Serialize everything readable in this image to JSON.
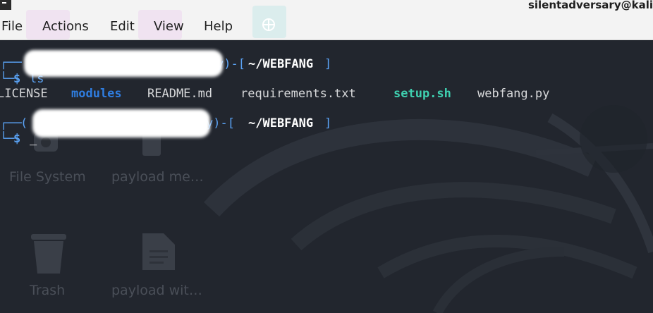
{
  "window": {
    "title": "silentadversary@kali"
  },
  "menubar": {
    "items": [
      "File",
      "Actions",
      "Edit",
      "View",
      "Help"
    ]
  },
  "terminal": {
    "prompt1": {
      "suffix": "y)-[",
      "path": "~/WEBFANG",
      "close": "]",
      "dollar": "$",
      "command": "ls"
    },
    "listing": [
      {
        "name": "LICENSE",
        "kind": "file"
      },
      {
        "name": "modules",
        "kind": "dir"
      },
      {
        "name": "README.md",
        "kind": "file"
      },
      {
        "name": "requirements.txt",
        "kind": "file"
      },
      {
        "name": "setup.sh",
        "kind": "exec"
      },
      {
        "name": "webfang.py",
        "kind": "file"
      }
    ],
    "prompt2": {
      "open_char": "(",
      "suffix": "y)-[",
      "path": "~/WEBFANG",
      "close": "]",
      "dollar": "$",
      "cursor": "_"
    }
  },
  "desktop": {
    "icons": [
      {
        "label": "File System",
        "icon": "drive-icon"
      },
      {
        "label": "payload me…",
        "icon": "file-icon"
      },
      {
        "label": "Trash",
        "icon": "trash-icon"
      },
      {
        "label": "payload wit…",
        "icon": "file-icon"
      }
    ]
  },
  "colors": {
    "menubar_bg": "#f3f3f3",
    "terminal_bg": "#22262e",
    "dir": "#2f7de0",
    "exec": "#3fd0b0",
    "prompt": "#5aa2f4"
  }
}
